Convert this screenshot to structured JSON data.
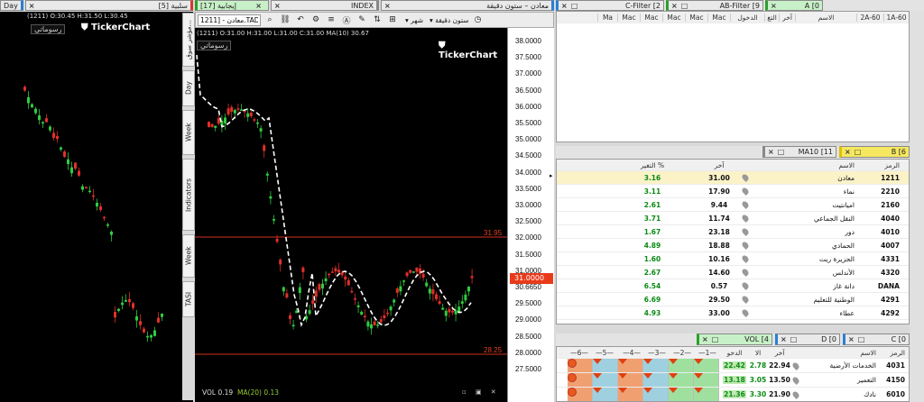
{
  "left_panel": {
    "tabs": [
      {
        "label": "Day",
        "color": "#2a7fd4"
      },
      {
        "label": "سلبية [5]",
        "color": "#d33"
      }
    ],
    "ohlc": "(1211) O:30.45 H:31.50 L:30.45",
    "drawings_label": "رسوماتي",
    "brand": "TickerChart"
  },
  "side_tabs": [
    "مؤشر سوق...",
    "Day",
    "Week",
    "Indicators",
    "Week",
    "TASI"
  ],
  "main_panel": {
    "tabs": [
      {
        "label": "معادن – ستون دقيقة",
        "color": "#2a7fd4"
      },
      {
        "label": "INDEX",
        "color": "#888"
      },
      {
        "label": "إيجابية [17]",
        "color": "#2aa02a"
      }
    ],
    "toolbar": {
      "interval_label": "ستون دقيقة",
      "period_label": "شهر",
      "symbol_value": "معادن - [1211.TAD"
    },
    "info": {
      "ohlc": "(1211) O:31.00 H:31.00 L:31.00 C:31.00",
      "ma": "MA(10) 30.67"
    },
    "drawings_label": "رسوماتي",
    "brand": "TickerChart",
    "price_axis": [
      "38.0000",
      "37.5000",
      "37.0000",
      "36.5000",
      "36.0000",
      "35.5000",
      "35.0000",
      "34.5000",
      "34.0000",
      "33.5000",
      "33.0000",
      "32.5000",
      "32.0000",
      "31.5000",
      "31.0000",
      "30.6650",
      "29.5000",
      "29.0000",
      "28.5000",
      "28.0000",
      "27.5000"
    ],
    "levels": {
      "upper": "31.95",
      "lower": "28.25"
    },
    "last_price": "31.0000",
    "vol_label": "VOL",
    "vol_value": "0.19",
    "vol_ma_label": "MA(20)",
    "vol_ma_value": "0.13"
  },
  "top_right": {
    "tabs": [
      {
        "label": "A [0",
        "color": "#2aa02a"
      },
      {
        "label": "AB-Filter [9",
        "color": "#2aa02a"
      },
      {
        "label": "C-Filter [2",
        "color": "#2a7fd4"
      }
    ],
    "columns": [
      "1A-60",
      "2A-60",
      "الاسم",
      "آخر",
      "التغ",
      "الدخول",
      "Mac",
      "Mac",
      "Mac",
      "Mac",
      "Mac",
      "Ma"
    ]
  },
  "watchlist": {
    "tabs": [
      {
        "label": "B [6",
        "color": "#e0c000"
      },
      {
        "label": "MA10 [11",
        "color": "#888"
      }
    ],
    "columns": {
      "symbol": "الرمز",
      "name": "الاسم",
      "last": "آخر",
      "change": "التغير %"
    },
    "rows": [
      {
        "symbol": "1211",
        "name": "معادن",
        "last": "31.00",
        "change": "3.16"
      },
      {
        "symbol": "2210",
        "name": "نماء",
        "last": "17.90",
        "change": "3.11"
      },
      {
        "symbol": "2160",
        "name": "اميانتيت",
        "last": "9.44",
        "change": "2.61"
      },
      {
        "symbol": "4040",
        "name": "النقل الجماعي",
        "last": "11.74",
        "change": "3.71"
      },
      {
        "symbol": "4010",
        "name": "دور",
        "last": "23.18",
        "change": "1.67"
      },
      {
        "symbol": "4007",
        "name": "الحمادي",
        "last": "18.88",
        "change": "4.89"
      },
      {
        "symbol": "4331",
        "name": "الجزيرة ريت",
        "last": "10.16",
        "change": "1.60"
      },
      {
        "symbol": "4320",
        "name": "الأندلس",
        "last": "14.60",
        "change": "2.67"
      },
      {
        "symbol": "DANA",
        "name": "دانة غاز",
        "last": "0.57",
        "change": "6.54"
      },
      {
        "symbol": "4291",
        "name": "الوطنية للتعليم",
        "last": "29.50",
        "change": "6.69"
      },
      {
        "symbol": "4292",
        "name": "عطاء",
        "last": "33.00",
        "change": "4.93"
      }
    ]
  },
  "bottom_right": {
    "tabs": [
      {
        "label": "C [0",
        "color": "#2a7fd4"
      },
      {
        "label": "D [0",
        "color": "#2a7fd4"
      },
      {
        "label": "VOL [4",
        "color": "#2aa02a"
      }
    ],
    "columns": {
      "symbol": "الرمز",
      "name": "الاسم",
      "last": "آخر",
      "change": "الا",
      "entry": "الدخو",
      "c1": "—1—",
      "c2": "—2—",
      "c3": "—3—",
      "c4": "—4—",
      "c5": "—5—",
      "c6": "—6—"
    },
    "rows": [
      {
        "symbol": "4031",
        "name": "الخدمات الأرضية",
        "last": "22.94",
        "change": "2.78",
        "entry": "22.42"
      },
      {
        "symbol": "4150",
        "name": "التعمير",
        "last": "13.50",
        "change": "3.05",
        "entry": "13.18"
      },
      {
        "symbol": "6010",
        "name": "نادك",
        "last": "21.90",
        "change": "3.30",
        "entry": "21.36"
      }
    ]
  }
}
